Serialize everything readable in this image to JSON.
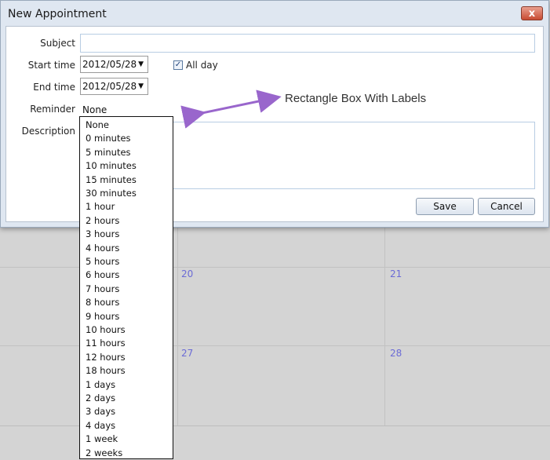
{
  "dialog": {
    "title": "New Appointment",
    "close_glyph": "x",
    "subject": {
      "label": "Subject",
      "value": ""
    },
    "start_time": {
      "label": "Start time",
      "value": "2012/05/28"
    },
    "all_day": {
      "label": "All day",
      "checked": true
    },
    "end_time": {
      "label": "End time",
      "value": "2012/05/28"
    },
    "reminder": {
      "label": "Reminder",
      "value": "None"
    },
    "description": {
      "label": "Description",
      "value": ""
    },
    "buttons": {
      "save": "Save",
      "cancel": "Cancel"
    }
  },
  "reminder_options": [
    "None",
    "0 minutes",
    "5 minutes",
    "10 minutes",
    "15 minutes",
    "30 minutes",
    "1 hour",
    "2 hours",
    "3 hours",
    "4 hours",
    "5 hours",
    "6 hours",
    "7 hours",
    "8 hours",
    "9 hours",
    "10 hours",
    "11 hours",
    "12 hours",
    "18 hours",
    "1 days",
    "2 days",
    "3 days",
    "4 days",
    "1 week",
    "2 weeks"
  ],
  "calendar": {
    "day_numbers": [
      "20",
      "21",
      "27",
      "28"
    ]
  },
  "annotation": {
    "text": "Rectangle Box With Labels",
    "color": "#9966cc"
  },
  "colors": {
    "day_number": "#6b6bd6",
    "close_button": "#c84b32"
  }
}
